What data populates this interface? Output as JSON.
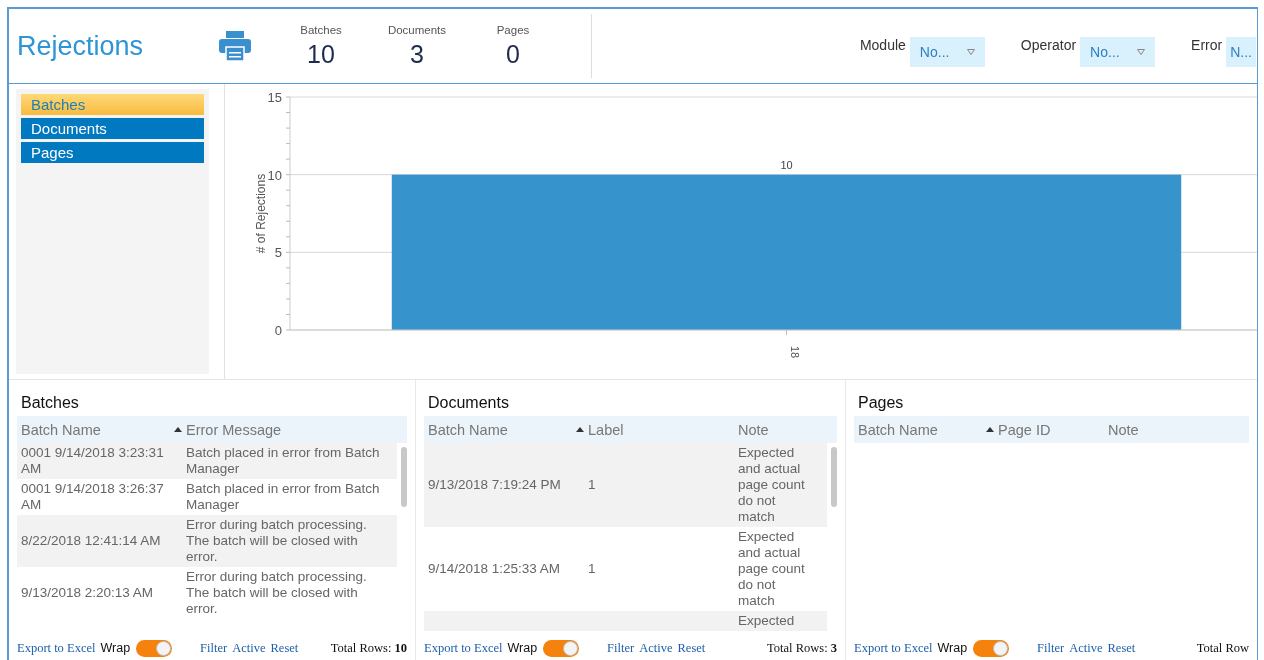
{
  "header": {
    "title": "Rejections",
    "stats": [
      {
        "label": "Batches",
        "value": "10"
      },
      {
        "label": "Documents",
        "value": "3"
      },
      {
        "label": "Pages",
        "value": "0"
      }
    ],
    "filters": [
      {
        "label": "Module",
        "value": "No..."
      },
      {
        "label": "Operator",
        "value": "No..."
      },
      {
        "label": "Error",
        "value": "N..."
      }
    ]
  },
  "sidebar": {
    "items": [
      {
        "label": "Batches",
        "selected": true
      },
      {
        "label": "Documents",
        "selected": false
      },
      {
        "label": "Pages",
        "selected": false
      }
    ]
  },
  "chart": {
    "chart_data": {
      "type": "bar",
      "ylabel": "# of Rejections",
      "categories": [
        "18"
      ],
      "values": [
        10
      ],
      "ylim": [
        0,
        15
      ],
      "yticks": [
        0,
        5,
        10,
        15
      ],
      "data_labels": true
    }
  },
  "panels": [
    {
      "title": "Batches",
      "columns": [
        {
          "label": "Batch Name",
          "sorted": true
        },
        {
          "label": "Error Message",
          "sorted": false
        }
      ],
      "rows": [
        [
          "0001 9/14/2018 3:23:31 AM",
          "Batch placed in error from Batch Manager"
        ],
        [
          "0001 9/14/2018 3:26:37 AM",
          "Batch placed in error from Batch Manager"
        ],
        [
          "8/22/2018 12:41:14 AM",
          "Error during batch processing. The batch will be closed with error."
        ],
        [
          "9/13/2018 2:20:13 AM",
          "Error during batch processing. The batch will be closed with error."
        ]
      ],
      "footer": {
        "export": "Export to Excel",
        "wrap": "Wrap",
        "wrap_on": true,
        "links": [
          "Filter",
          "Active",
          "Reset"
        ],
        "total": "Total Rows: **10**"
      }
    },
    {
      "title": "Documents",
      "columns": [
        {
          "label": "Batch Name",
          "sorted": true
        },
        {
          "label": "Label",
          "sorted": false
        },
        {
          "label": "Note",
          "sorted": false
        }
      ],
      "rows": [
        [
          "9/13/2018 7:19:24 PM",
          "1",
          "Expected and actual page count do not match"
        ],
        [
          "9/14/2018 1:25:33 AM",
          "1",
          "Expected and actual page count do not match"
        ],
        [
          "",
          "",
          "Expected"
        ]
      ],
      "footer": {
        "export": "Export to Excel",
        "wrap": "Wrap",
        "wrap_on": true,
        "links": [
          "Filter",
          "Active",
          "Reset"
        ],
        "total": "Total Rows: **3**"
      }
    },
    {
      "title": "Pages",
      "columns": [
        {
          "label": "Batch Name",
          "sorted": true
        },
        {
          "label": "Page ID",
          "sorted": false
        },
        {
          "label": "Note",
          "sorted": false
        }
      ],
      "footer": {
        "export": "Export to Excel",
        "wrap": "Wrap",
        "wrap_on": true,
        "links": [
          "Filter",
          "Active",
          "Reset"
        ],
        "total": "Total Row"
      }
    }
  ]
}
